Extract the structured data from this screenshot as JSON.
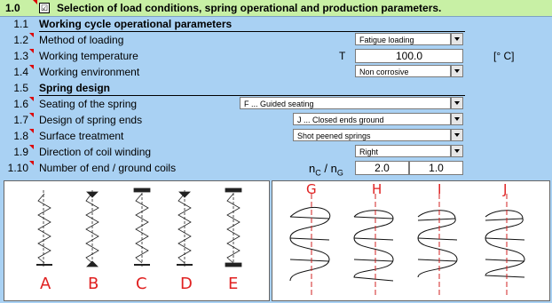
{
  "header": {
    "num": "1.0",
    "checkbox": "☑",
    "title": "Selection of load conditions, spring operational and production parameters."
  },
  "rows": [
    {
      "num": "1.1",
      "label": "Working cycle operational parameters"
    },
    {
      "num": "1.2",
      "label": "Method of loading"
    },
    {
      "num": "1.3",
      "label": "Working temperature"
    },
    {
      "num": "1.4",
      "label": "Working environment"
    },
    {
      "num": "1.5",
      "label": "Spring design"
    },
    {
      "num": "1.6",
      "label": "Seating of the spring"
    },
    {
      "num": "1.7",
      "label": "Design of spring ends"
    },
    {
      "num": "1.8",
      "label": "Surface treatment"
    },
    {
      "num": "1.9",
      "label": "Direction of coil winding"
    },
    {
      "num": "1.10",
      "label": "Number of end / ground coils"
    }
  ],
  "fields": {
    "loading": "Fatigue loading",
    "temp_symbol": "T",
    "temp_value": "100.0",
    "temp_unit": "[° C]",
    "environment": "Non corrosive",
    "seating": "F ... Guided seating",
    "ends": "J ... Closed ends ground",
    "surface": "Shot peened springs",
    "direction": "Right",
    "coils_symbol_n": "n",
    "coils_symbol_c": "C",
    "coils_symbol_sep": " / n",
    "coils_symbol_g": "G",
    "nc": "2.0",
    "ng": "1.0"
  },
  "images": {
    "left_labels": [
      "A",
      "B",
      "C",
      "D",
      "E"
    ],
    "right_labels": [
      "G",
      "H",
      "I",
      "J"
    ]
  },
  "colors": {
    "background": "#a9d1f3",
    "header": "#c8f0a5",
    "mark": "#dd0000",
    "label": "#e02020"
  }
}
